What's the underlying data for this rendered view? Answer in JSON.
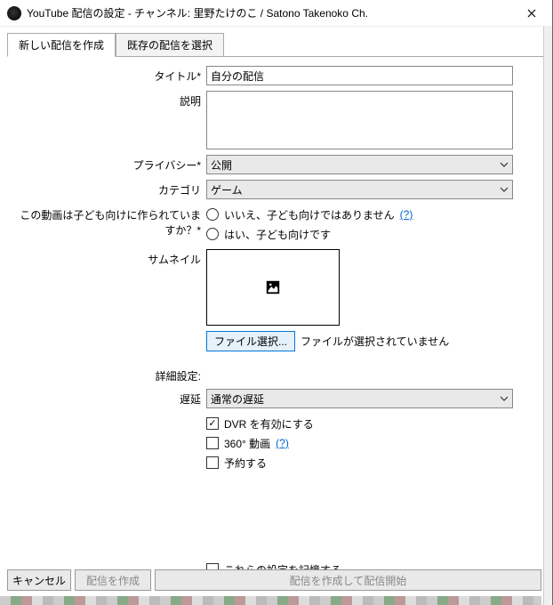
{
  "window": {
    "title": "YouTube 配信の設定 - チャンネル: 里野たけのこ / Satono Takenoko Ch."
  },
  "tabs": {
    "new": "新しい配信を作成",
    "existing": "既存の配信を選択"
  },
  "labels": {
    "title": "タイトル*",
    "description": "説明",
    "privacy": "プライバシー*",
    "category": "カテゴリ",
    "kids_q": "この動画は子ども向けに作られていますか？*",
    "thumbnail": "サムネイル",
    "advanced": "詳細設定:",
    "latency": "遅延"
  },
  "values": {
    "title_value": "自分の配信",
    "description_value": "",
    "privacy_selected": "公開",
    "category_selected": "ゲーム",
    "latency_selected": "通常の遅延",
    "file_chosen_text": "ファイルが選択されていません"
  },
  "radios": {
    "not_kids": "いいえ、子ども向けではありません",
    "kids": "はい、子ども向けです"
  },
  "checks": {
    "dvr": "DVR を有効にする",
    "v360": "360° 動画",
    "schedule": "予約する",
    "remember": "これらの設定を記憶する"
  },
  "help": "(?)",
  "buttons": {
    "choose_file": "ファイル選択...",
    "cancel": "キャンセル",
    "create": "配信を作成",
    "create_start": "配信を作成して配信開始"
  }
}
